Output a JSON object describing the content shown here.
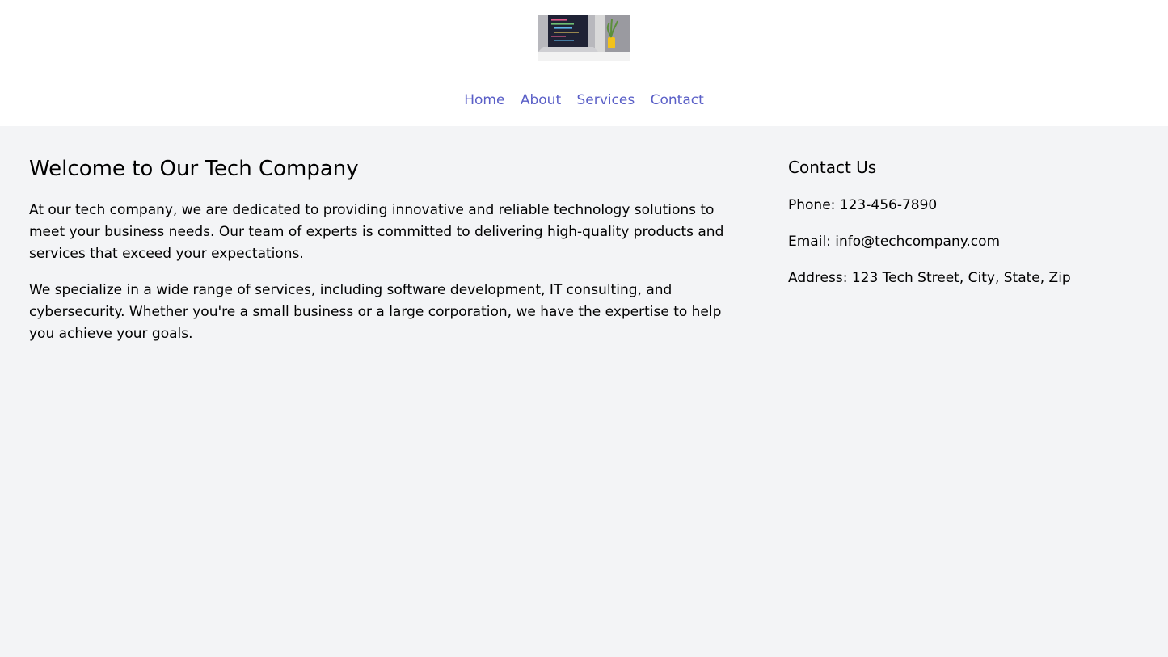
{
  "header": {
    "logo_icon": "laptop-code-photo-icon",
    "nav": [
      {
        "label": "Home"
      },
      {
        "label": "About"
      },
      {
        "label": "Services"
      },
      {
        "label": "Contact"
      }
    ]
  },
  "main": {
    "title": "Welcome to Our Tech Company",
    "paragraphs": [
      "At our tech company, we are dedicated to providing innovative and reliable technology solutions to meet your business needs. Our team of experts is committed to delivering high-quality products and services that exceed your expectations.",
      "We specialize in a wide range of services, including software development, IT consulting, and cybersecurity. Whether you're a small business or a large corporation, we have the expertise to help you achieve your goals."
    ]
  },
  "contact": {
    "title": "Contact Us",
    "phone": "Phone: 123-456-7890",
    "email": "Email: info@techcompany.com",
    "address": "Address: 123 Tech Street, City, State, Zip"
  },
  "colors": {
    "link": "#5a5fc7",
    "background": "#f3f4f6",
    "header_background": "#ffffff"
  }
}
